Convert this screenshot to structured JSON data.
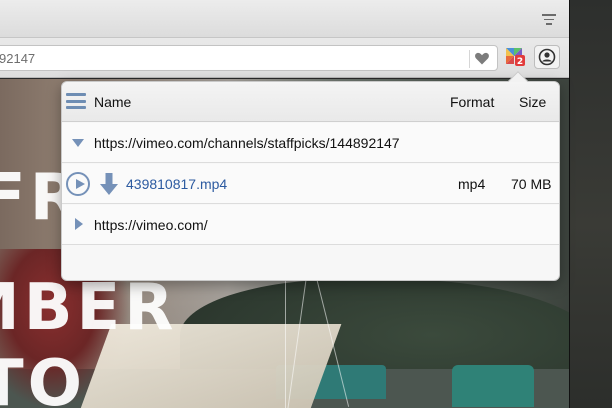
{
  "browser": {
    "url_text": "92147",
    "colors": {
      "accent": "#7591b8",
      "link": "#2c5aa0"
    }
  },
  "page": {
    "banner_lines": [
      "FR",
      "MBER",
      "TO"
    ]
  },
  "popup": {
    "header": {
      "name": "Name",
      "format": "Format",
      "size": "Size"
    },
    "rows": [
      {
        "kind": "group",
        "expanded": true,
        "label": "https://vimeo.com/channels/staffpicks/144892147"
      },
      {
        "kind": "file",
        "filename": "439810817.mp4",
        "format": "mp4",
        "size": "70 MB"
      },
      {
        "kind": "group",
        "expanded": false,
        "label": "https://vimeo.com/"
      }
    ]
  },
  "extension_badge": "2",
  "icons": {
    "tab_menu": "list-menu-icon",
    "heart": "heart-icon",
    "extension": "video-downloader-icon",
    "account": "account-icon",
    "play": "play-icon",
    "download": "download-arrow-icon",
    "expand": "chevron-down-icon",
    "collapse": "chevron-right-icon"
  }
}
